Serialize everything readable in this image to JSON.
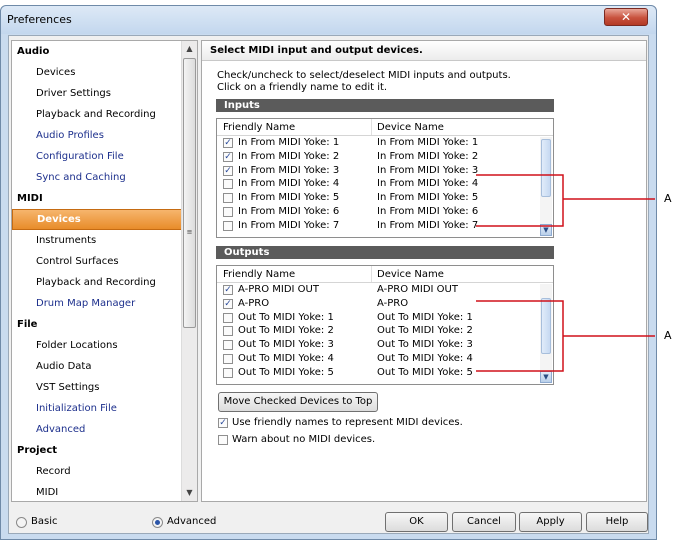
{
  "window": {
    "title": "Preferences",
    "close_glyph": "✕"
  },
  "sidebar": {
    "groups": [
      {
        "category": "Audio",
        "items": [
          {
            "label": "Devices",
            "style": "normal"
          },
          {
            "label": "Driver Settings",
            "style": "normal"
          },
          {
            "label": "Playback and Recording",
            "style": "normal"
          },
          {
            "label": "Audio Profiles",
            "style": "link"
          },
          {
            "label": "Configuration File",
            "style": "link"
          },
          {
            "label": "Sync and Caching",
            "style": "link"
          }
        ]
      },
      {
        "category": "MIDI",
        "items": [
          {
            "label": "Devices",
            "style": "selected"
          },
          {
            "label": "Instruments",
            "style": "normal"
          },
          {
            "label": "Control Surfaces",
            "style": "normal"
          },
          {
            "label": "Playback and Recording",
            "style": "normal"
          },
          {
            "label": "Drum Map Manager",
            "style": "link"
          }
        ]
      },
      {
        "category": "File",
        "items": [
          {
            "label": "Folder Locations",
            "style": "normal"
          },
          {
            "label": "Audio Data",
            "style": "normal"
          },
          {
            "label": "VST Settings",
            "style": "normal"
          },
          {
            "label": "Initialization File",
            "style": "link"
          },
          {
            "label": "Advanced",
            "style": "link"
          }
        ]
      },
      {
        "category": "Project",
        "items": [
          {
            "label": "Record",
            "style": "normal"
          },
          {
            "label": "MIDI",
            "style": "normal"
          }
        ]
      }
    ]
  },
  "main": {
    "header": "Select MIDI input and output devices.",
    "description_line1": "Check/uncheck to select/deselect MIDI inputs and outputs.",
    "description_line2": "Click on a friendly name to edit it.",
    "inputs": {
      "title": "Inputs",
      "col_friendly": "Friendly Name",
      "col_device": "Device Name",
      "rows": [
        {
          "checked": true,
          "friendly": "In From MIDI Yoke:  1",
          "device": "In From MIDI Yoke:  1"
        },
        {
          "checked": true,
          "friendly": "In From MIDI Yoke:  2",
          "device": "In From MIDI Yoke:  2"
        },
        {
          "checked": true,
          "friendly": "In From MIDI Yoke:  3",
          "device": "In From MIDI Yoke:  3"
        },
        {
          "checked": false,
          "friendly": "In From MIDI Yoke:  4",
          "device": "In From MIDI Yoke:  4"
        },
        {
          "checked": false,
          "friendly": "In From MIDI Yoke:  5",
          "device": "In From MIDI Yoke:  5"
        },
        {
          "checked": false,
          "friendly": "In From MIDI Yoke:  6",
          "device": "In From MIDI Yoke:  6"
        },
        {
          "checked": false,
          "friendly": "In From MIDI Yoke:  7",
          "device": "In From MIDI Yoke:  7"
        }
      ]
    },
    "outputs": {
      "title": "Outputs",
      "col_friendly": "Friendly Name",
      "col_device": "Device Name",
      "rows": [
        {
          "checked": true,
          "friendly": "A-PRO MIDI OUT",
          "device": "A-PRO MIDI OUT"
        },
        {
          "checked": true,
          "friendly": "A-PRO",
          "device": "A-PRO"
        },
        {
          "checked": false,
          "friendly": "Out To MIDI Yoke:  1",
          "device": "Out To MIDI Yoke:  1"
        },
        {
          "checked": false,
          "friendly": "Out To MIDI Yoke:  2",
          "device": "Out To MIDI Yoke:  2"
        },
        {
          "checked": false,
          "friendly": "Out To MIDI Yoke:  3",
          "device": "Out To MIDI Yoke:  3"
        },
        {
          "checked": false,
          "friendly": "Out To MIDI Yoke:  4",
          "device": "Out To MIDI Yoke:  4"
        },
        {
          "checked": false,
          "friendly": "Out To MIDI Yoke:  5",
          "device": "Out To MIDI Yoke:  5"
        }
      ]
    },
    "move_button": "Move Checked Devices to Top",
    "option_friendly": {
      "checked": true,
      "label": "Use friendly names to represent MIDI devices."
    },
    "option_warn": {
      "checked": false,
      "label": "Warn about no MIDI devices."
    }
  },
  "footer": {
    "basic_label": "Basic",
    "advanced_label": "Advanced",
    "advanced_selected": true,
    "ok": "OK",
    "cancel": "Cancel",
    "apply": "Apply",
    "help": "Help"
  },
  "callouts": {
    "inputs_label": "A",
    "outputs_label": "A"
  }
}
